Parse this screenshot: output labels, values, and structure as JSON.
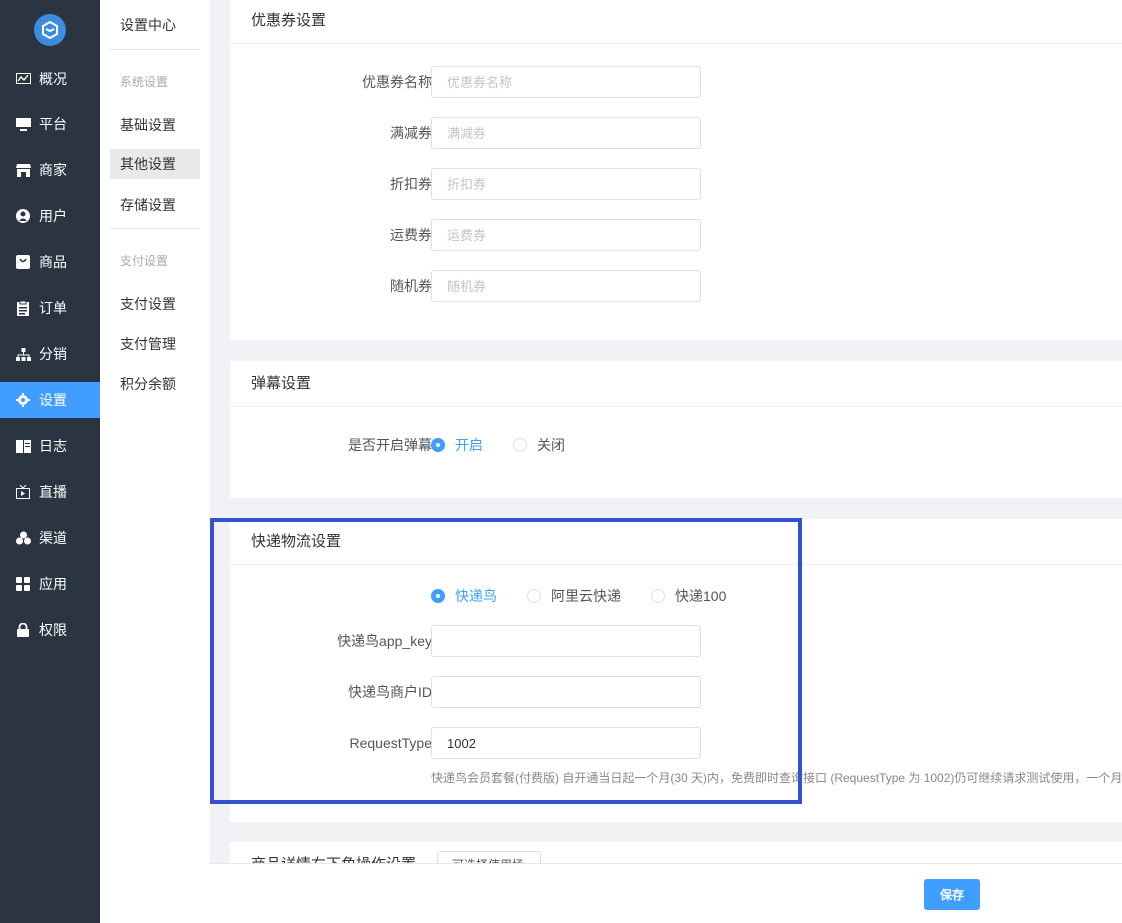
{
  "nav": {
    "items": [
      {
        "label": "概况",
        "icon": "chart-icon"
      },
      {
        "label": "平台",
        "icon": "monitor-icon"
      },
      {
        "label": "商家",
        "icon": "store-icon"
      },
      {
        "label": "用户",
        "icon": "user-icon"
      },
      {
        "label": "商品",
        "icon": "bag-icon"
      },
      {
        "label": "订单",
        "icon": "clipboard-icon"
      },
      {
        "label": "分销",
        "icon": "sitemap-icon"
      },
      {
        "label": "设置",
        "icon": "gear-icon"
      },
      {
        "label": "日志",
        "icon": "book-icon"
      },
      {
        "label": "直播",
        "icon": "tv-icon"
      },
      {
        "label": "渠道",
        "icon": "cluster-icon"
      },
      {
        "label": "应用",
        "icon": "grid-icon"
      },
      {
        "label": "权限",
        "icon": "lock-icon"
      }
    ],
    "active_color": "#409eff"
  },
  "submenu": {
    "title": "设置中心",
    "group1": "系统设置",
    "items1": [
      "基础设置",
      "其他设置",
      "存储设置"
    ],
    "group2": "支付设置",
    "items2": [
      "支付设置",
      "支付管理",
      "积分余额"
    ]
  },
  "coupon": {
    "title": "优惠券设置",
    "fields": [
      {
        "label": "优惠券名称",
        "placeholder": "优惠券名称",
        "value": ""
      },
      {
        "label": "满减券",
        "placeholder": "满减券",
        "value": ""
      },
      {
        "label": "折扣券",
        "placeholder": "折扣券",
        "value": ""
      },
      {
        "label": "运费券",
        "placeholder": "运费券",
        "value": ""
      },
      {
        "label": "随机券",
        "placeholder": "随机券",
        "value": ""
      }
    ]
  },
  "barrage": {
    "title": "弹幕设置",
    "label": "是否开启弹幕",
    "options": [
      "开启",
      "关闭"
    ],
    "selected": "开启"
  },
  "express": {
    "title": "快递物流设置",
    "options": [
      "快递鸟",
      "阿里云快递",
      "快递100"
    ],
    "selected": "快递鸟",
    "fields": [
      {
        "label": "快递鸟app_key",
        "value": ""
      },
      {
        "label": "快递鸟商户ID",
        "value": ""
      },
      {
        "label": "RequestType",
        "value": "1002"
      }
    ],
    "hint": "快递鸟会员套餐(付费版) 自开通当日起一个月(30 天)内，免费即时查询接口 (RequestType 为 1002)仍可继续请求测试使用，一个月"
  },
  "next_section": {
    "title": "商品详情右下角操作设置",
    "button": "可选择使用场"
  },
  "footer": {
    "save_label": "保存"
  }
}
